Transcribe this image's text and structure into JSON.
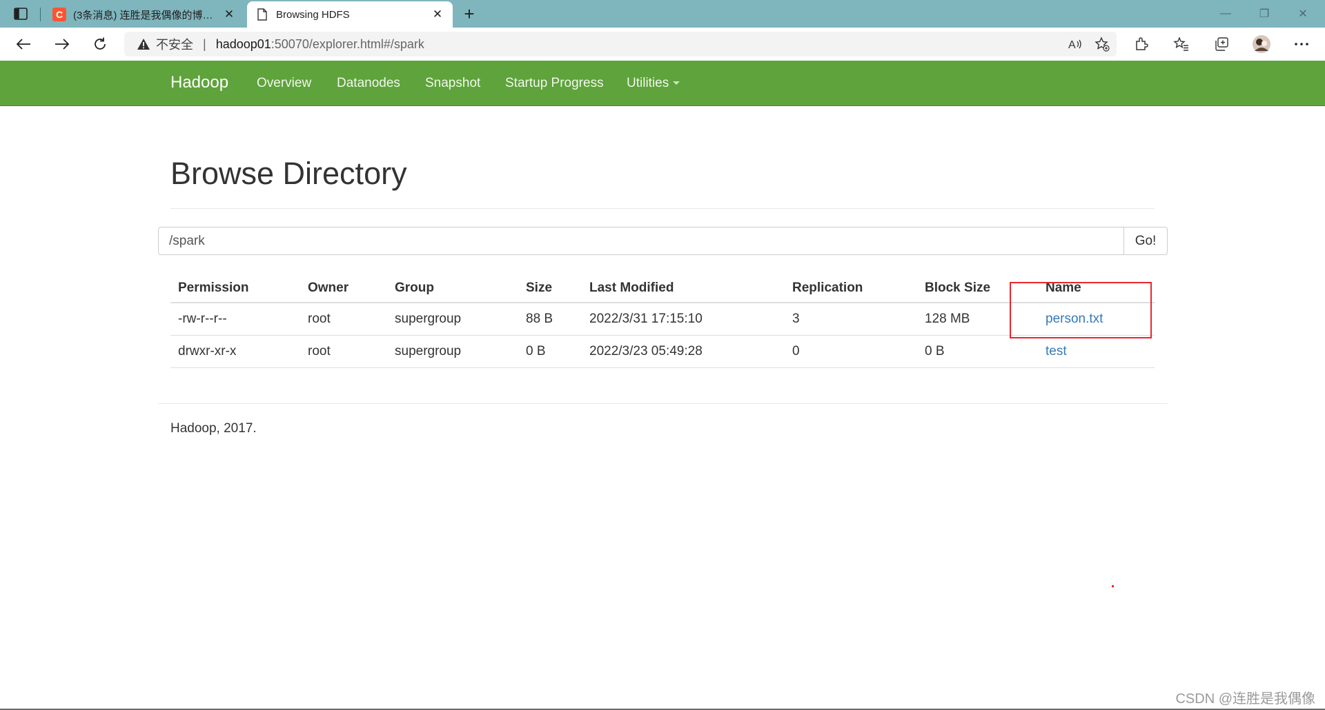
{
  "browser": {
    "tabs": [
      {
        "title": "(3条消息) 连胜是我偶像的博客_C",
        "favicon_letter": "C",
        "favicon_color": "#fc5531",
        "active": false
      },
      {
        "title": "Browsing HDFS",
        "active": true
      }
    ],
    "new_tab_symbol": "+",
    "window_controls": {
      "minimize": "—",
      "restore": "❐",
      "close": "✕"
    },
    "address": {
      "insecure_label": "不安全",
      "separator": "|",
      "host": "hadoop01",
      "path": ":50070/explorer.html#/spark"
    },
    "accent": "#7fb5bd"
  },
  "hadoop_nav": {
    "brand": "Hadoop",
    "items": [
      "Overview",
      "Datanodes",
      "Snapshot",
      "Startup Progress",
      "Utilities"
    ],
    "background": "#5ea33b"
  },
  "page": {
    "title": "Browse Directory",
    "path_value": "/spark",
    "go_label": "Go!"
  },
  "table": {
    "headers": [
      "Permission",
      "Owner",
      "Group",
      "Size",
      "Last Modified",
      "Replication",
      "Block Size",
      "Name"
    ],
    "rows": [
      [
        "-rw-r--r--",
        "root",
        "supergroup",
        "88 B",
        "2022/3/31 17:15:10",
        "3",
        "128 MB",
        "person.txt"
      ],
      [
        "drwxr-xr-x",
        "root",
        "supergroup",
        "0 B",
        "2022/3/23 05:49:28",
        "0",
        "0 B",
        "test"
      ]
    ],
    "link_color": "#337ab7"
  },
  "footer": {
    "text": "Hadoop, 2017."
  },
  "watermark": {
    "text": "CSDN @连胜是我偶像"
  },
  "annotation_color": "#e8262b"
}
